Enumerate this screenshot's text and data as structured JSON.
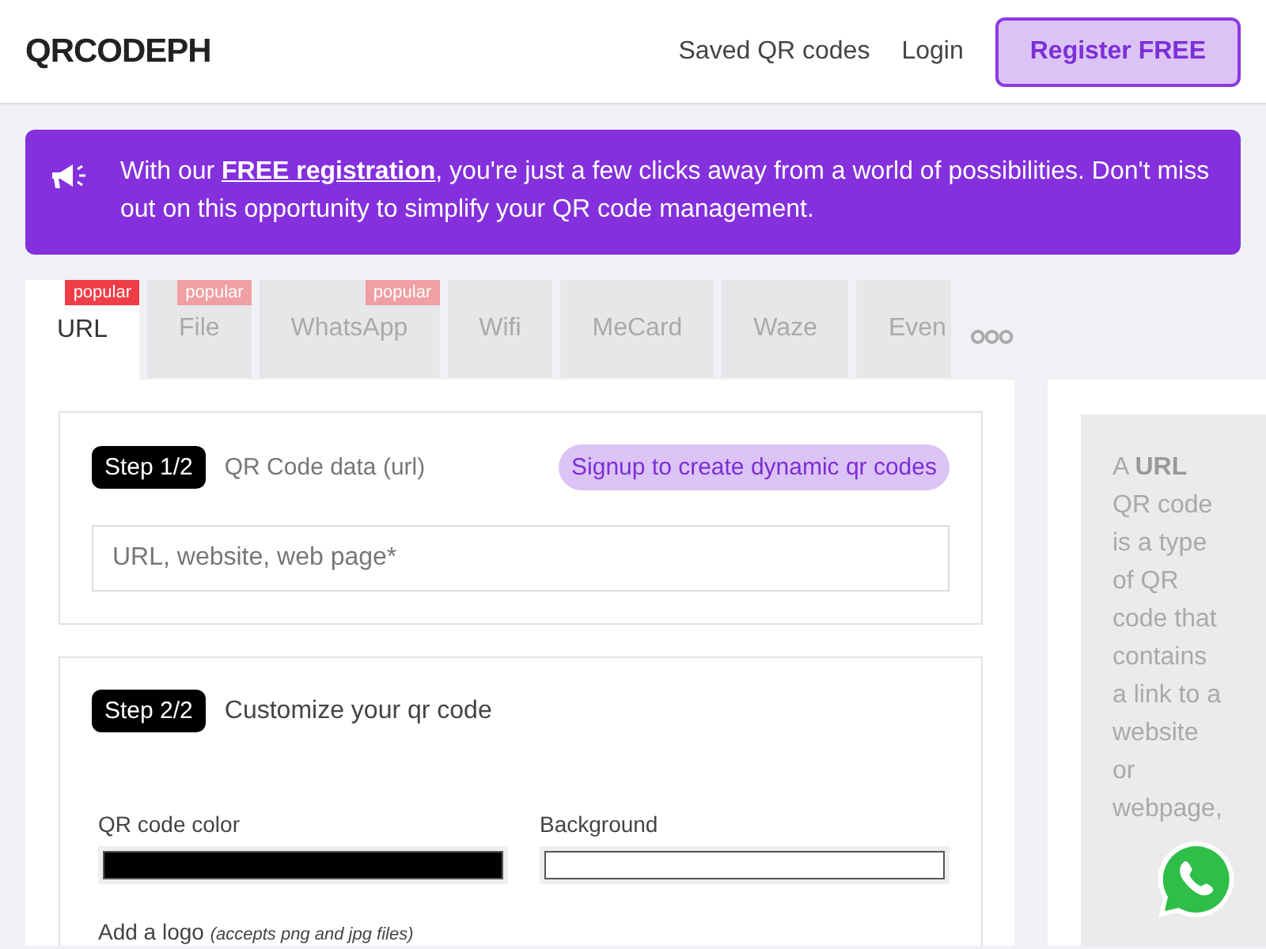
{
  "header": {
    "logo": "QRCODEPH",
    "nav": [
      "Saved QR codes",
      "Login"
    ],
    "register_button": "Register FREE"
  },
  "banner": {
    "before": "With our ",
    "link": "FREE registration",
    "after": ", you're just a few clicks away from a world of possibilities. Don't miss out on this opportunity to simplify your QR code management."
  },
  "tabs": [
    {
      "label": "URL",
      "badge": "popular",
      "selected": true
    },
    {
      "label": "File",
      "badge": "popular",
      "selected": false
    },
    {
      "label": "WhatsApp",
      "badge": "popular",
      "selected": false
    },
    {
      "label": "Wifi",
      "selected": false
    },
    {
      "label": "MeCard",
      "selected": false
    },
    {
      "label": "Waze",
      "selected": false
    },
    {
      "label": "Even",
      "selected": false
    }
  ],
  "step1": {
    "step": "Step 1/2",
    "title": "QR Code data (url)",
    "signup_button": "Signup to create dynamic qr codes",
    "input": {
      "placeholder": "URL, website, web page*"
    }
  },
  "step2": {
    "step": "Step 2/2",
    "title": "Customize your qr code",
    "colors": [
      {
        "label": "QR code color",
        "color": "#000000"
      },
      {
        "label": "Background",
        "color": "#ffffff"
      }
    ],
    "logo_label": "Add a logo",
    "logo_hint": "(accepts png and jpg files)"
  },
  "side_info": {
    "text": "A **URL** QR code is a type of QR code that contains a link to a website or webpage,"
  }
}
